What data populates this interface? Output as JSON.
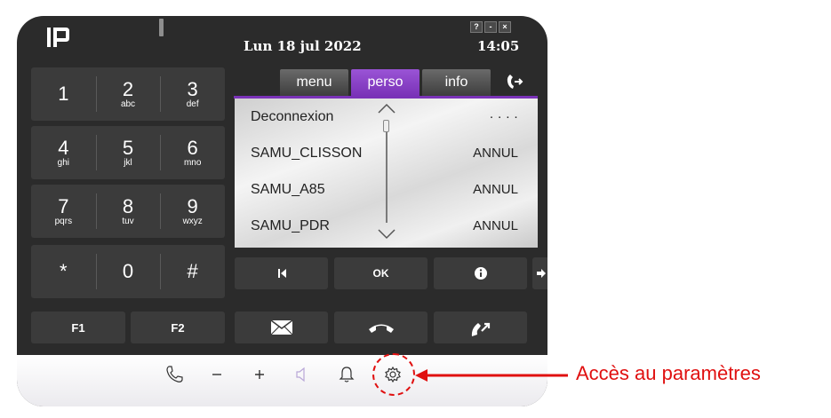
{
  "header": {
    "date": "Lun 18 jul 2022",
    "time": "14:05"
  },
  "window_buttons": [
    "?",
    "-",
    "×"
  ],
  "keypad": [
    [
      {
        "digit": "1",
        "letters": ""
      },
      {
        "digit": "2",
        "letters": "abc"
      },
      {
        "digit": "3",
        "letters": "def"
      }
    ],
    [
      {
        "digit": "4",
        "letters": "ghi"
      },
      {
        "digit": "5",
        "letters": "jkl"
      },
      {
        "digit": "6",
        "letters": "mno"
      }
    ],
    [
      {
        "digit": "7",
        "letters": "pqrs"
      },
      {
        "digit": "8",
        "letters": "tuv"
      },
      {
        "digit": "9",
        "letters": "wxyz"
      }
    ],
    [
      {
        "digit": "*",
        "letters": ""
      },
      {
        "digit": "0",
        "letters": ""
      },
      {
        "digit": "#",
        "letters": ""
      }
    ]
  ],
  "fkeys": [
    "F1",
    "F2"
  ],
  "tabs": [
    {
      "label": "menu",
      "active": false
    },
    {
      "label": "perso",
      "active": true
    },
    {
      "label": "info",
      "active": false
    }
  ],
  "list": [
    {
      "name": "Deconnexion",
      "value": "· · · ·"
    },
    {
      "name": "SAMU_CLISSON",
      "value": "ANNUL"
    },
    {
      "name": "SAMU_A85",
      "value": "ANNUL"
    },
    {
      "name": "SAMU_PDR",
      "value": "ANNUL"
    }
  ],
  "nav": {
    "ok_label": "OK"
  },
  "annotation": {
    "text": "Accès au paramètres"
  },
  "colors": {
    "accent": "#7a32b8",
    "annotation": "#e01010",
    "body": "#2b2b2b",
    "key": "#3b3b3b"
  }
}
